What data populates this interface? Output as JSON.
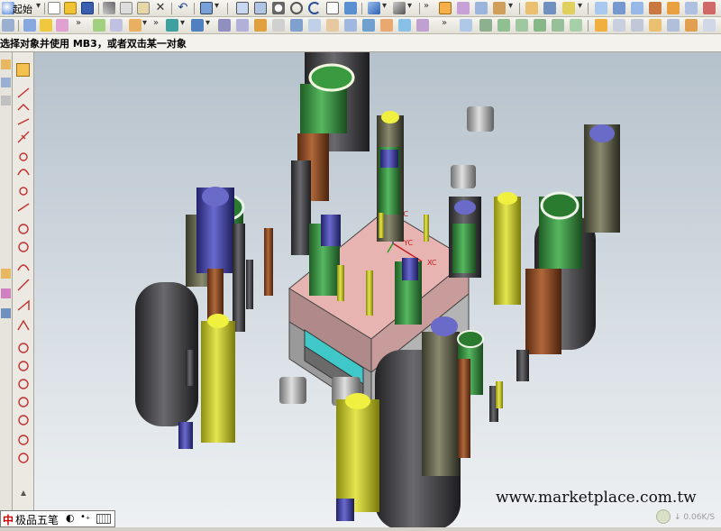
{
  "toolbar": {
    "start_label": "起始",
    "dropdown_chevron": "▾",
    "overflow_chevron": "»"
  },
  "hint": {
    "text": "选择对象并使用  MB3，或者双击某一对象"
  },
  "ime": {
    "label": "极品五笔",
    "moon_glyph": "◐",
    "dot_glyph": "•₊"
  },
  "viewport": {
    "coordinate_labels": [
      "ZC",
      "YC",
      "XC"
    ]
  },
  "watermark": {
    "text": "www.marketplace.com.tw"
  },
  "network_speed": {
    "text": "↓ 0.06K/S"
  },
  "colors": {
    "toolbar_bg": "#ece9d8",
    "viewport_top": "#b5c1cb",
    "mold_plate": "#e7b7b4",
    "cylinder_dark": "#3c3c3e",
    "cylinder_green": "#2f8f3a",
    "cylinder_blue": "#3c3c8f",
    "cylinder_yellow": "#cfd01e",
    "cylinder_brown": "#8a4a28"
  }
}
